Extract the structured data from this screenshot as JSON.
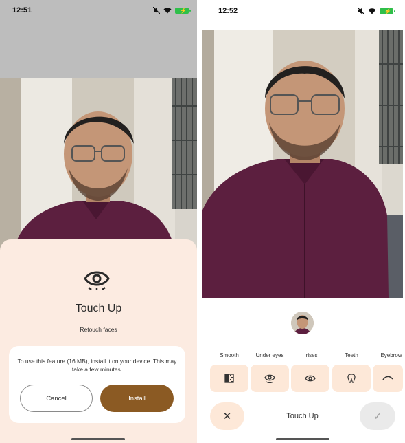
{
  "left_screen": {
    "status": {
      "time": "12:51"
    },
    "sheet": {
      "title": "Touch Up",
      "subtitle": "Retouch faces",
      "message": "To use this feature (16 MB), install it on your device. This may take a few minutes.",
      "cancel_label": "Cancel",
      "install_label": "Install"
    },
    "colors": {
      "sheet_bg": "#fcebe1",
      "install_button": "#8b5a23"
    }
  },
  "right_screen": {
    "status": {
      "time": "12:52"
    },
    "tools": [
      {
        "label": "Smooth",
        "icon": "smooth-gradient-icon"
      },
      {
        "label": "Under eyes",
        "icon": "under-eye-icon"
      },
      {
        "label": "Irises",
        "icon": "eye-icon"
      },
      {
        "label": "Teeth",
        "icon": "tooth-icon"
      },
      {
        "label": "Eyebrow",
        "icon": "eyebrow-icon"
      }
    ],
    "bottom": {
      "title": "Touch Up",
      "close_icon": "close-icon",
      "done_icon": "check-icon"
    },
    "colors": {
      "tool_bg": "#fde8d8"
    }
  }
}
